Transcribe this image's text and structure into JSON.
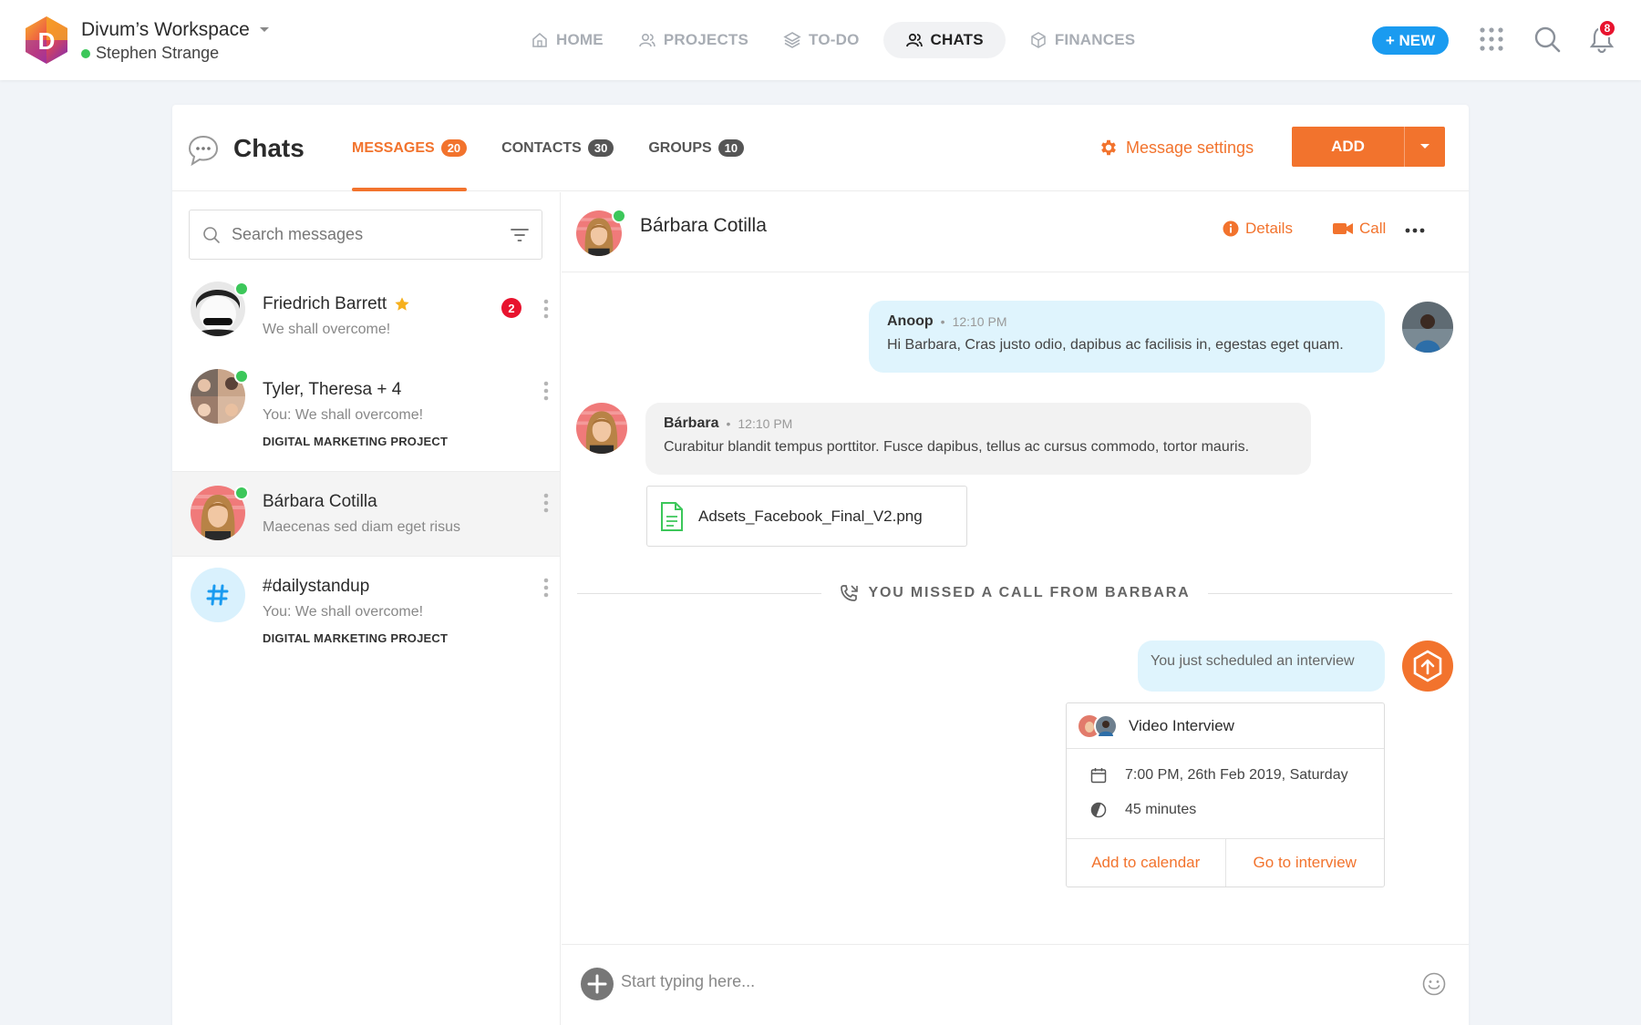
{
  "workspace": {
    "logo_letter": "D",
    "name": "Divum’s Workspace",
    "user": "Stephen Strange"
  },
  "nav": [
    {
      "label": "HOME",
      "icon": "home-icon",
      "active": false
    },
    {
      "label": "PROJECTS",
      "icon": "users-icon",
      "active": false
    },
    {
      "label": "TO-DO",
      "icon": "layers-icon",
      "active": false
    },
    {
      "label": "CHATS",
      "icon": "users-icon",
      "active": true
    },
    {
      "label": "FINANCES",
      "icon": "box-icon",
      "active": false
    }
  ],
  "topbar": {
    "new_label": "+ NEW",
    "notification_count": "8"
  },
  "header": {
    "title": "Chats",
    "tabs": [
      {
        "label": "MESSAGES",
        "count": "20",
        "active": true
      },
      {
        "label": "CONTACTS",
        "count": "30",
        "active": false
      },
      {
        "label": "GROUPS",
        "count": "10",
        "active": false
      }
    ],
    "settings_label": "Message settings",
    "add_label": "ADD"
  },
  "search": {
    "placeholder": "Search messages"
  },
  "conversations": [
    {
      "name": "Friedrich Barrett",
      "preview": "We shall overcome!",
      "project": "",
      "starred": true,
      "unread": "2",
      "online": true
    },
    {
      "name": "Tyler, Theresa + 4",
      "preview": "You: We shall overcome!",
      "project": "DIGITAL MARKETING PROJECT",
      "starred": false,
      "unread": "",
      "online": true
    },
    {
      "name": "Bárbara Cotilla",
      "preview": "Maecenas sed diam eget risus",
      "project": "",
      "starred": false,
      "unread": "",
      "online": true,
      "selected": true
    },
    {
      "name": "#dailystandup",
      "preview": "You: We shall overcome!",
      "project": "DIGITAL MARKETING PROJECT",
      "starred": false,
      "unread": "",
      "online": false
    }
  ],
  "chat": {
    "contact_name": "Bárbara Cotilla",
    "details_label": "Details",
    "call_label": "Call",
    "messages": [
      {
        "author": "Anoop",
        "time": "12:10 PM",
        "text": "Hi Barbara, Cras justo odio, dapibus ac facilisis in, egestas eget quam."
      },
      {
        "author": "Bárbara",
        "time": "12:10 PM",
        "text": "Curabitur blandit tempus porttitor. Fusce dapibus, tellus ac cursus commodo, tortor mauris."
      }
    ],
    "attachment": "Adsets_Facebook_Final_V2.png",
    "missed_call": "YOU MISSED A CALL FROM BARBARA",
    "system_message": "You just scheduled an interview",
    "interview": {
      "title": "Video Interview",
      "datetime": "7:00 PM, 26th Feb 2019, Saturday",
      "duration": "45 minutes",
      "add_calendar": "Add to calendar",
      "go_interview": "Go to interview"
    },
    "composer_placeholder": "Start typing here..."
  },
  "colors": {
    "accent": "#f2732d",
    "blue": "#1a9bf0",
    "online": "#3cc75a",
    "badge": "#e8132e",
    "sent_bubble": "#dff4fd",
    "received_bubble": "#f2f2f2"
  }
}
